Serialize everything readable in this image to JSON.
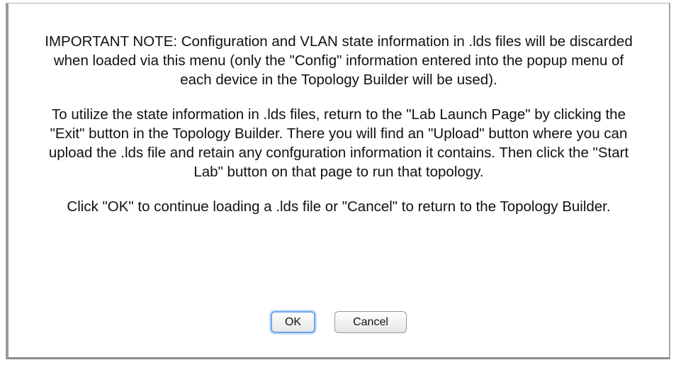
{
  "dialog": {
    "paragraphs": [
      "IMPORTANT NOTE: Configuration and VLAN state information in .lds files will be discarded when loaded via this menu (only the \"Config\" information entered into the popup menu of each device in the Topology Builder will be used).",
      "To utilize the state information in .lds files, return to the \"Lab Launch Page\" by clicking the \"Exit\" button in the Topology Builder. There you will find an \"Upload\" button where you can upload the .lds file and retain any confguration information it contains. Then click the \"Start Lab\" button on that page to run that topology.",
      "Click \"OK\" to continue loading a .lds file or \"Cancel\" to return to the Topology Builder."
    ],
    "buttons": {
      "ok_label": "OK",
      "cancel_label": "Cancel"
    }
  },
  "colors": {
    "focus_ring": "#6fa6e8",
    "text": "#111111"
  }
}
